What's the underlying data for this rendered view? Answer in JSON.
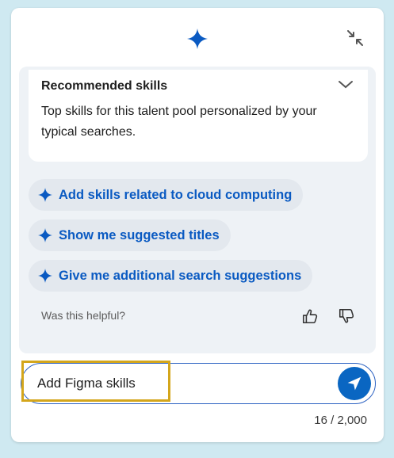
{
  "recommended": {
    "title": "Recommended skills",
    "description": "Top skills for this talent pool personalized by your typical searches."
  },
  "suggestions": [
    {
      "label": "Add skills related to cloud computing"
    },
    {
      "label": "Show me suggested titles"
    },
    {
      "label": "Give me additional search suggestions"
    }
  ],
  "feedback": {
    "prompt": "Was this helpful?"
  },
  "input": {
    "value": "Add Figma skills",
    "counter": "16 / 2,000"
  },
  "icons": {
    "header": "sparkle-icon",
    "collapse": "collapse-arrows-icon",
    "chevron": "chevron-down-icon",
    "thumbs_up": "thumbs-up-icon",
    "thumbs_down": "thumbs-down-icon",
    "send": "send-icon"
  },
  "colors": {
    "accent": "#0a66c2",
    "highlight": "#d4a61b"
  }
}
